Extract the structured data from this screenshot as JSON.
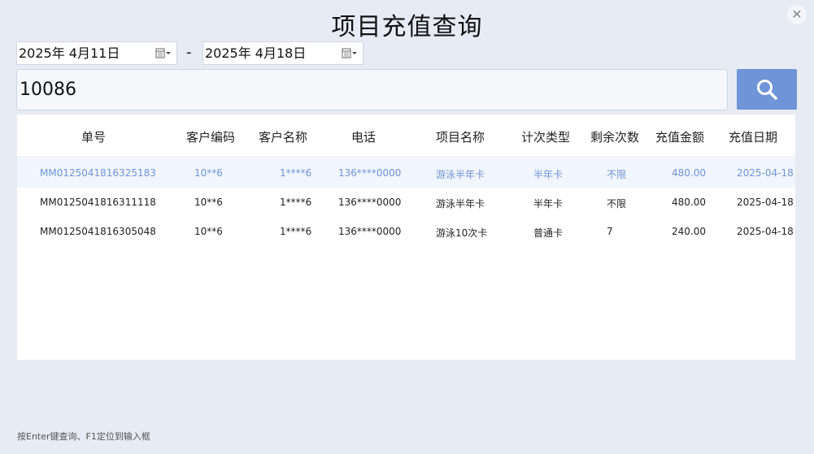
{
  "title": "项目充值查询",
  "close_glyph": "✕",
  "date_from": "2025年  4月11日",
  "date_to": "2025年  4月18日",
  "date_separator": "-",
  "search": {
    "value": "10086",
    "icon": "search-icon",
    "button_color": "#6f94d7"
  },
  "table": {
    "columns": [
      "单号",
      "客户编码",
      "客户名称",
      "电话",
      "项目名称",
      "计次类型",
      "剩余次数",
      "充值金额",
      "充值日期"
    ],
    "rows": [
      [
        "MM0125041816325183",
        "10**6",
        "1****6",
        "136****0000",
        "游泳半年卡",
        "半年卡",
        "不限",
        "480.00",
        "2025-04-18"
      ],
      [
        "MM0125041816311118",
        "10**6",
        "1****6",
        "136****0000",
        "游泳半年卡",
        "半年卡",
        "不限",
        "480.00",
        "2025-04-18"
      ],
      [
        "MM0125041816305048",
        "10**6",
        "1****6",
        "136****0000",
        "游泳10次卡",
        "普通卡",
        "7",
        "240.00",
        "2025-04-18"
      ]
    ],
    "selected_row": 0,
    "selected_color": "#6f94d7"
  },
  "footer_hint": "按Enter键查询、F1定位到输入框"
}
